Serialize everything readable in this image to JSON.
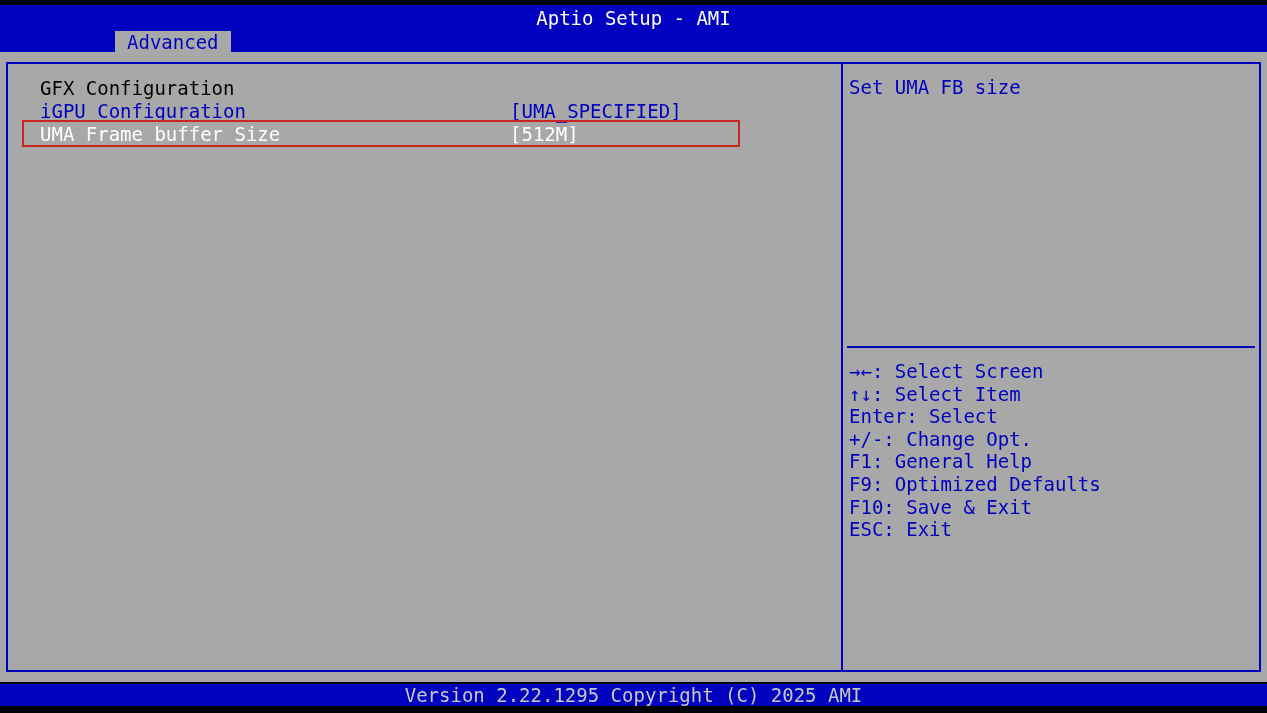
{
  "window": {
    "title": "Aptio Setup - AMI"
  },
  "tabs": [
    {
      "label": "Advanced",
      "selected": true
    }
  ],
  "items": [
    {
      "kind": "heading",
      "label": "GFX Configuration"
    },
    {
      "kind": "submenu",
      "label": "iGPU Configuration",
      "value": "[UMA_SPECIFIED]",
      "selected": false
    },
    {
      "kind": "setting",
      "label": "UMA Frame buffer Size",
      "value": "[512M]",
      "selected": true
    }
  ],
  "help": {
    "text": "Set UMA FB size"
  },
  "key_hints": [
    "→←: Select Screen",
    "↑↓: Select Item",
    "Enter: Select",
    "+/-: Change Opt.",
    "F1: General Help",
    "F9: Optimized Defaults",
    "F10: Save & Exit",
    "ESC: Exit"
  ],
  "status_bar": {
    "text": "Version 2.22.1295 Copyright (C) 2025 AMI"
  }
}
